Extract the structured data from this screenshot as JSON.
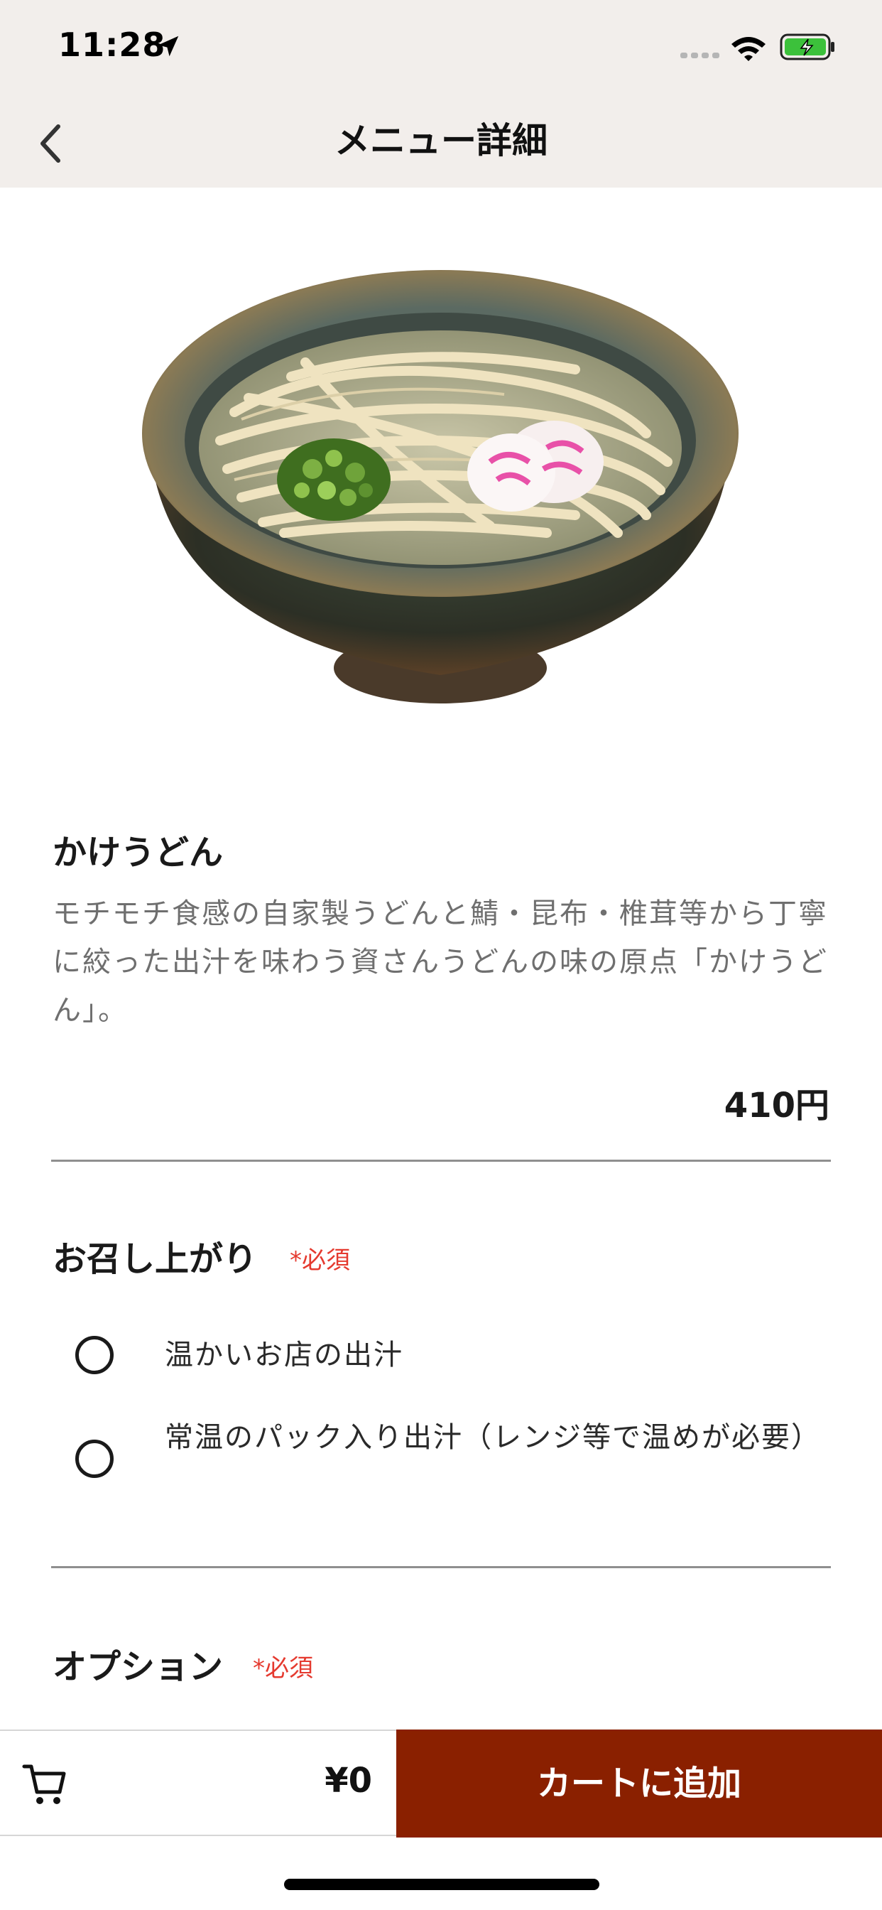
{
  "status_bar": {
    "time": "11:28"
  },
  "nav": {
    "title": "メニュー詳細"
  },
  "item": {
    "name": "かけうどん",
    "description": "モチモチ食感の自家製うどんと鯖・昆布・椎茸等から丁寧に絞った出汁を味わう資さんうどんの味の原点「かけうどん」。",
    "price": "410円"
  },
  "sections": [
    {
      "title": "お召し上がり",
      "required_label": "*必須",
      "options": [
        {
          "label": "温かいお店の出汁",
          "selected": false
        },
        {
          "label": "常温のパック入り出汁（レンジ等で温めが必要）",
          "selected": false
        }
      ]
    },
    {
      "title": "オプション",
      "required_label": "*必須"
    }
  ],
  "cart": {
    "total": "¥0",
    "add_button_label": "カートに追加"
  },
  "colors": {
    "header_bg": "#f2eeeb",
    "accent": "#8a2000",
    "required": "#e53a2f"
  },
  "icons": [
    "location-arrow-icon",
    "signal-icon",
    "wifi-icon",
    "battery-charging-icon",
    "chevron-left-icon",
    "cart-icon"
  ]
}
